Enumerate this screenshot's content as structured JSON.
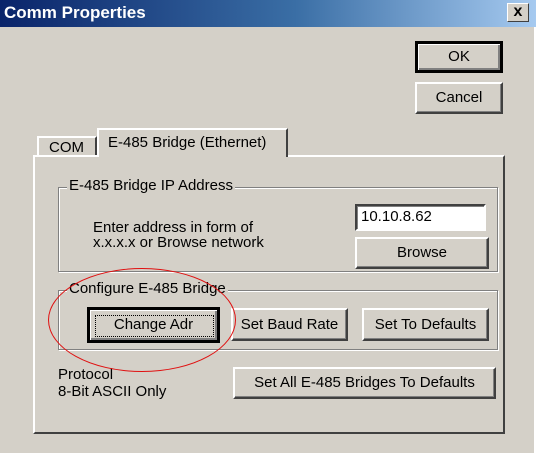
{
  "window": {
    "title": "Comm Properties",
    "close_label": "x"
  },
  "buttons": {
    "ok": "OK",
    "cancel": "Cancel"
  },
  "tabs": [
    {
      "label": "COM",
      "active": false
    },
    {
      "label": "E-485 Bridge (Ethernet)",
      "active": true
    }
  ],
  "ip_group": {
    "legend": "E-485 Bridge IP Address",
    "hint_line1": "Enter address in form of",
    "hint_line2": "x.x.x.x or Browse network",
    "address_value": "10.10.8.62",
    "browse_label": "Browse"
  },
  "config_group": {
    "legend": "Configure E-485 Bridge",
    "change_adr_label": "Change Adr",
    "set_baud_label": "Set Baud Rate",
    "set_defaults_label": "Set To Defaults"
  },
  "protocol": {
    "line1": "Protocol",
    "line2": "8-Bit ASCII Only"
  },
  "set_all_label": "Set All E-485 Bridges To Defaults",
  "colors": {
    "dialog_bg": "#d4d0c8",
    "title_bar_start": "#0a246a",
    "highlight_ellipse": "#e01010"
  }
}
